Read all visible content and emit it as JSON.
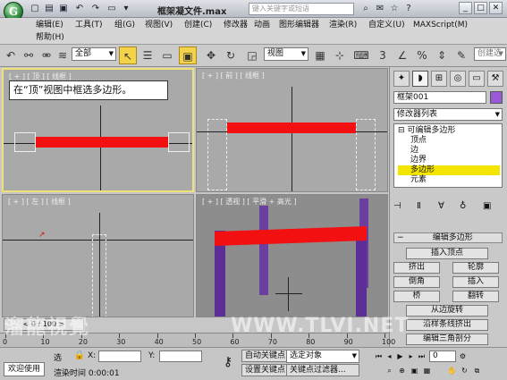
{
  "title": {
    "app_logo": "G",
    "doc_title": "框架凝文件.max",
    "search_placeholder": "键入关键字或短语"
  },
  "menu": [
    "编辑(E)",
    "工具(T)",
    "组(G)",
    "视图(V)",
    "创建(C)",
    "修改器",
    "动画",
    "图形编辑器",
    "渲染(R)",
    "自定义(U)",
    "MAXScript(M)",
    "帮助(H)"
  ],
  "toolbar": {
    "selection_filter": "全部",
    "ref_coord": "视图",
    "create_selection_set": "创建选"
  },
  "viewports": {
    "top_label": "[ + ] [ 顶 ] [ 线框 ]",
    "front_label": "[ + ] [ 前 ] [ 线框 ]",
    "left_label": "[ + ] [ 左 ] [ 线框 ]",
    "persp_label": "[ + ] [ 透视 ] [ 平滑 + 高光 ]"
  },
  "callout": "在“顶”视图中框选多边形。",
  "command_panel": {
    "object_name": "框架001",
    "object_color": "#9b59d9",
    "modifier_list": "修改器列表",
    "stack": [
      "可编辑多边形",
      "顶点",
      "边",
      "边界",
      "多边形",
      "元素"
    ],
    "selected_stack_index": 4,
    "rollout_title": "编辑多边形",
    "buttons": [
      "插入顶点",
      "挤出",
      "轮廓",
      "倒角",
      "插入",
      "桥",
      "翻转",
      "从边旋转",
      "沿样条线挤出",
      "编辑三角剖分"
    ]
  },
  "timeline": {
    "frame_display": "0 / 100",
    "ticks": [
      "0",
      "10",
      "20",
      "30",
      "40",
      "50",
      "60",
      "70",
      "80",
      "90",
      "100"
    ]
  },
  "status": {
    "welcome": "欢迎使用",
    "select_label": "选",
    "x_label": "X:",
    "y_label": "Y:",
    "render_time": "渲染时间 0:00:01",
    "auto_key": "自动关键点",
    "set_key": "设置关键点",
    "selected_object": "选定对象",
    "key_filters": "关键点过滤器...",
    "frame_field": "0"
  },
  "watermark": {
    "left": "溜龍視覺",
    "right": "WWW.TLVI.NET"
  },
  "colors": {
    "selection_red": "#f21010",
    "active_border": "#f0e07a",
    "highlight": "#f4e500"
  }
}
